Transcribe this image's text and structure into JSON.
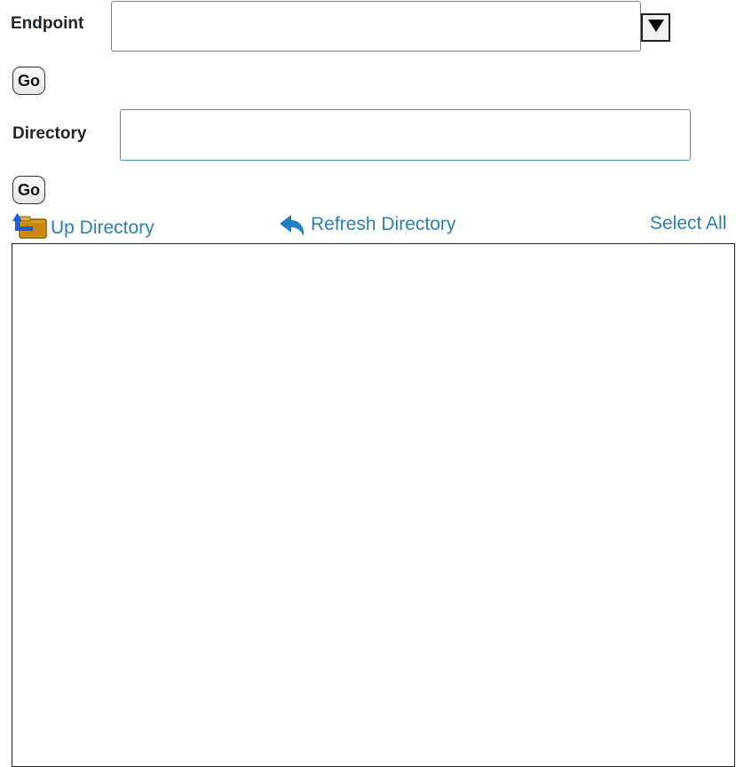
{
  "endpoint": {
    "label": "Endpoint",
    "value": "",
    "placeholder": "",
    "dropdown_icon": "triangle-down-icon",
    "go_label": "Go"
  },
  "directory": {
    "label": "Directory",
    "value": "",
    "placeholder": "",
    "go_label": "Go"
  },
  "toolbar": {
    "up_directory": {
      "label": "Up Directory",
      "icon": "folder-up-icon"
    },
    "refresh_directory": {
      "label": "Refresh Directory",
      "icon": "refresh-arrow-icon"
    },
    "select_all": {
      "label": "Select All"
    }
  },
  "file_list": {
    "items": []
  },
  "colors": {
    "link": "#2c7fae",
    "input_border": "#4a8bb8",
    "label_text": "#1f2428",
    "refresh_icon": "#1f7fc2",
    "folder": "#d99a1e",
    "folder_arrow": "#1b5fd6"
  }
}
